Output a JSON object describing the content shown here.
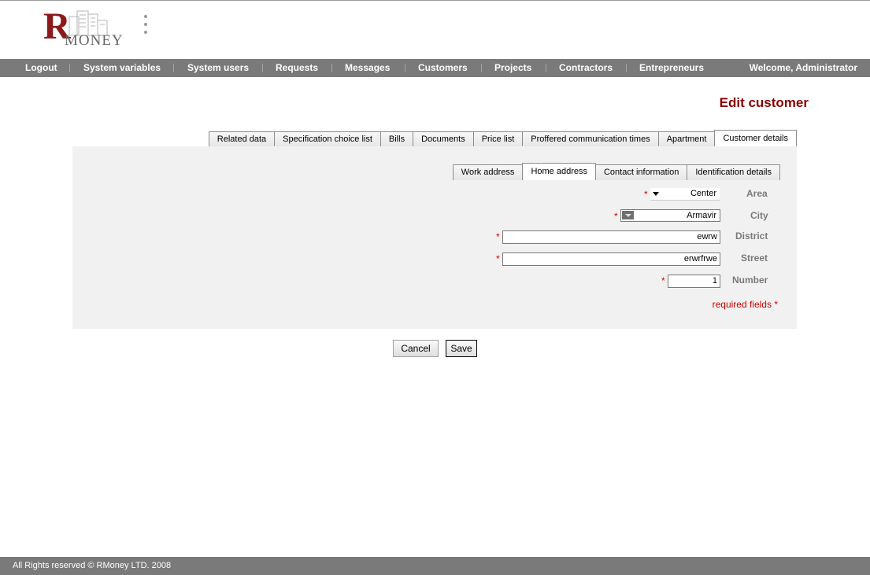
{
  "brand": {
    "letter": "R",
    "word": "MONEY"
  },
  "nav": {
    "items": [
      {
        "label": "Logout"
      },
      {
        "label": "System variables"
      },
      {
        "label": "System users"
      },
      {
        "label": "Requests"
      },
      {
        "label": "Messages"
      },
      {
        "label": "Customers"
      },
      {
        "label": "Projects"
      },
      {
        "label": "Contractors"
      },
      {
        "label": "Entrepreneurs"
      }
    ],
    "welcome": "Welcome, Administrator"
  },
  "page": {
    "title": "Edit customer"
  },
  "outer_tabs": [
    {
      "label": "Related data"
    },
    {
      "label": "Specification choice list"
    },
    {
      "label": "Bills"
    },
    {
      "label": "Documents"
    },
    {
      "label": "Price list"
    },
    {
      "label": "Proffered communication times"
    },
    {
      "label": "Apartment"
    },
    {
      "label": "Customer details",
      "active": true
    }
  ],
  "inner_tabs": [
    {
      "label": "Work address"
    },
    {
      "label": "Home address",
      "active": true
    },
    {
      "label": "Contact information"
    },
    {
      "label": "Identification details"
    }
  ],
  "form": {
    "required_mark": "*",
    "area": {
      "label": "Area",
      "value": "Center"
    },
    "city": {
      "label": "City",
      "value": "Armavir"
    },
    "district": {
      "label": "District",
      "value": "ewrw"
    },
    "street": {
      "label": "Street",
      "value": "erwrfrwe"
    },
    "number": {
      "label": "Number",
      "value": "1"
    },
    "required_note": "required fields *"
  },
  "buttons": {
    "cancel": "Cancel",
    "save": "Save"
  },
  "footer": {
    "text": "All Rights reserved © RMoney LTD. 2008"
  },
  "colors": {
    "nav_bg": "#7a7a7a",
    "title": "#8b0000",
    "required": "#cc0000",
    "panel_bg": "#f2f1f1"
  }
}
